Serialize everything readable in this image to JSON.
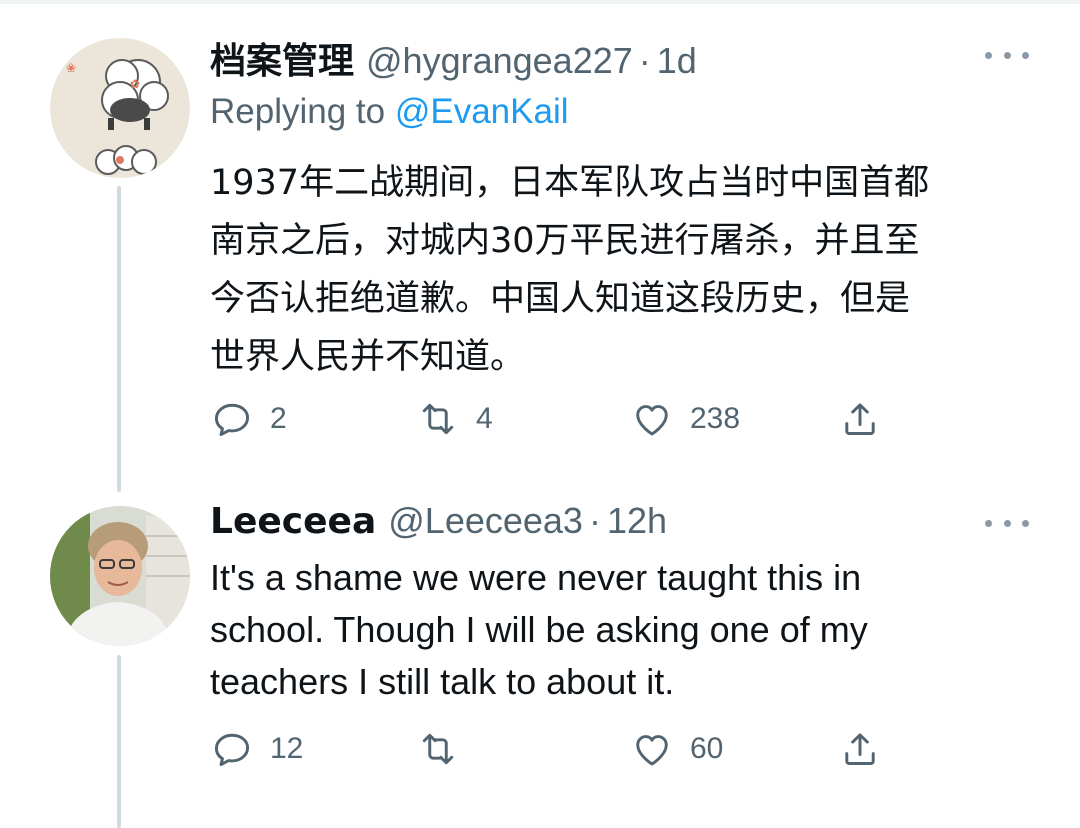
{
  "tweets": [
    {
      "display_name": "档案管理",
      "handle": "@hygrangea227",
      "separator": "·",
      "time": "1d",
      "replying_prefix": "Replying to",
      "replying_to": "@EvanKail",
      "text": "1937年二战期间，日本军队攻占当时中国首都\n南京之后，对城内30万平民进行屠杀，并且至\n今否认拒绝道歉。中国人知道这段历史，但是\n世界人民并不知道。",
      "replies": "2",
      "retweets": "4",
      "likes": "238"
    },
    {
      "display_name": "Leeceea",
      "handle": "@Leeceea3",
      "separator": "·",
      "time": "12h",
      "text": "It's a shame we were never taught this in\nschool. Though I will be asking one of my\nteachers I still talk to about it.",
      "replies": "12",
      "retweets": "",
      "likes": "60"
    }
  ],
  "icons": {
    "reply": "reply-icon",
    "retweet": "retweet-icon",
    "like": "heart-icon",
    "share": "share-icon",
    "more": "more-icon"
  },
  "colors": {
    "text_primary": "#0f1419",
    "text_secondary": "#536471",
    "link": "#1d9bf0",
    "thread_line": "#cfd9de"
  }
}
